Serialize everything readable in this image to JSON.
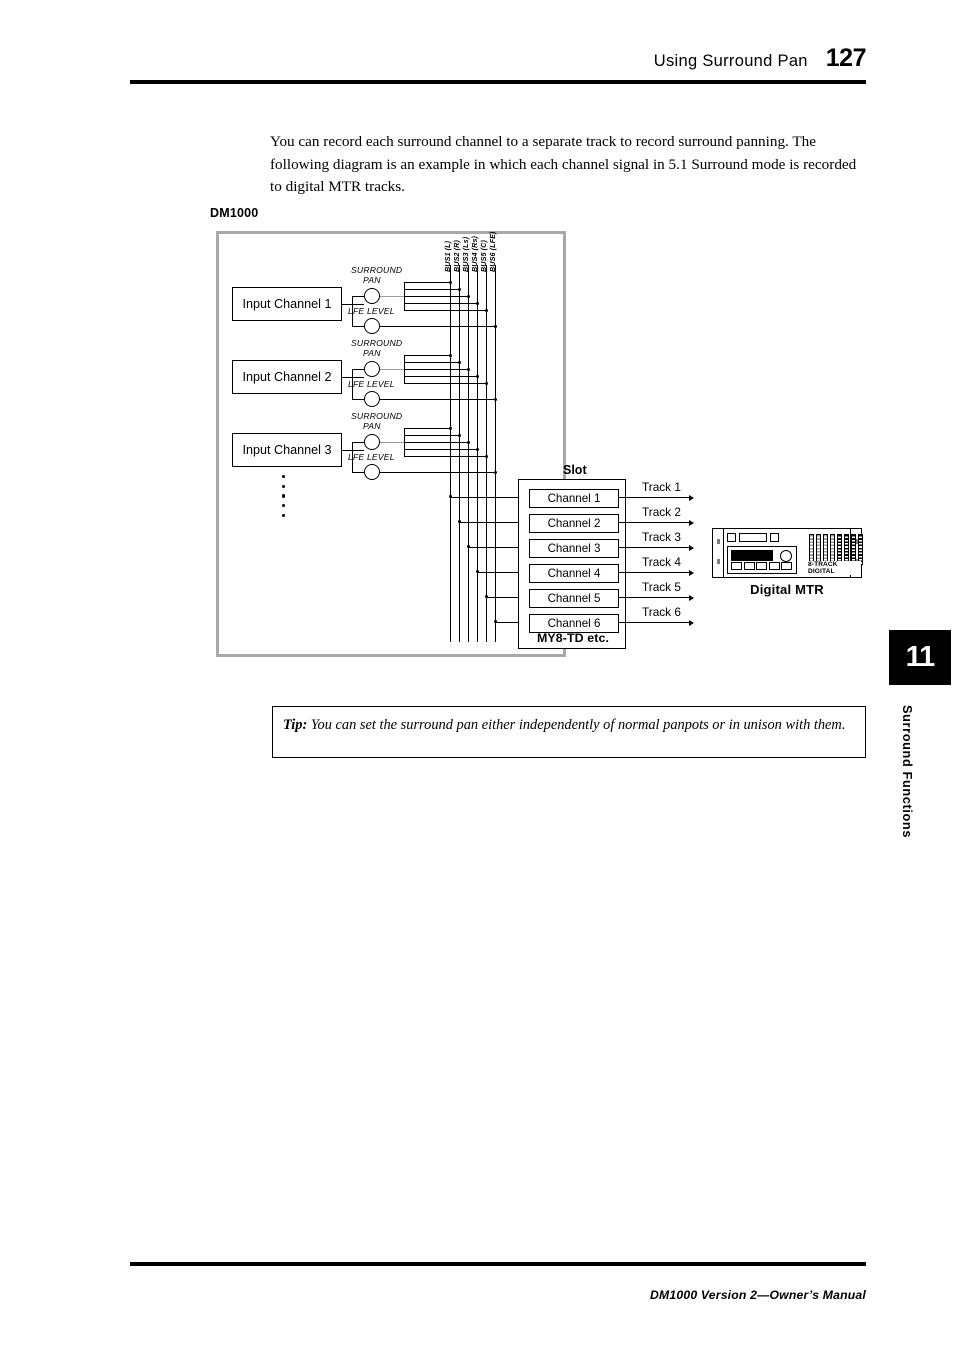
{
  "header": {
    "title": "Using Surround Pan",
    "page_number": "127"
  },
  "intro_paragraph": "You can record each surround channel to a separate track to record surround panning. The following diagram is an example in which each channel signal in 5.1 Surround mode is recorded to digital MTR tracks.",
  "diagram": {
    "device_label": "DM1000",
    "input_channels": [
      {
        "label": "Input Channel 1",
        "pan_label": "SURROUND PAN",
        "lfe_label": "LFE LEVEL"
      },
      {
        "label": "Input Channel 2",
        "pan_label": "SURROUND PAN",
        "lfe_label": "LFE LEVEL"
      },
      {
        "label": "Input Channel 3",
        "pan_label": "SURROUND PAN",
        "lfe_label": "LFE LEVEL"
      }
    ],
    "knob_labels": {
      "surround_pan_line1": "SURROUND",
      "surround_pan_line2": "PAN",
      "lfe_level": "LFE LEVEL"
    },
    "bus_labels": [
      "BUS1 (L)",
      "BUS2 (R)",
      "BUS3 (Ls)",
      "BUS4 (Rs)",
      "BUS5 (C)",
      "BUS6 (LFE)"
    ],
    "slot": {
      "label": "Slot",
      "model": "MY8-TD etc.",
      "channels": [
        "Channel 1",
        "Channel 2",
        "Channel 3",
        "Channel 4",
        "Channel 5",
        "Channel 6"
      ]
    },
    "tracks": [
      "Track 1",
      "Track 2",
      "Track 3",
      "Track 4",
      "Track 5",
      "Track 6"
    ],
    "mtr": {
      "caption": "Digital MTR",
      "meter_label": "8-TRACK DIGITAL"
    }
  },
  "tip": {
    "label": "Tip:",
    "text": "You can set the surround pan either independently of normal panpots or in unison with them."
  },
  "chapter": {
    "number": "11",
    "name": "Surround Functions"
  },
  "footer": {
    "text": "DM1000 Version 2—Owner’s Manual"
  },
  "colors": {
    "rule": "#000000",
    "enclosure_border": "#a8a8a8",
    "tab_background": "#000000"
  }
}
